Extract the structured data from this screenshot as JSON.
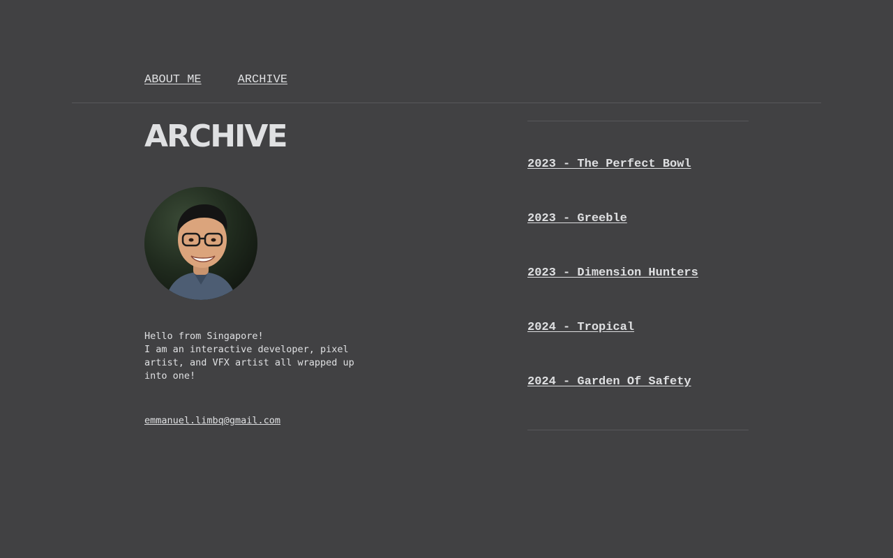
{
  "nav": {
    "items": [
      {
        "label": "ABOUT ME"
      },
      {
        "label": "ARCHIVE"
      }
    ]
  },
  "page": {
    "title": "ARCHIVE"
  },
  "profile": {
    "bio_line1": "Hello from Singapore!",
    "bio_line2": "I am an interactive developer, pixel artist, and VFX artist all wrapped up into one!",
    "email": "emmanuel.limbq@gmail.com"
  },
  "archive": {
    "items": [
      {
        "label": "2023 - The Perfect Bowl"
      },
      {
        "label": "2023 - Greeble"
      },
      {
        "label": "2023 - Dimension Hunters"
      },
      {
        "label": "2024 - Tropical"
      },
      {
        "label": "2024 - Garden Of Safety"
      }
    ]
  },
  "colors": {
    "background": "#414143",
    "text": "#dfe0e2",
    "divider": "#58585b"
  }
}
